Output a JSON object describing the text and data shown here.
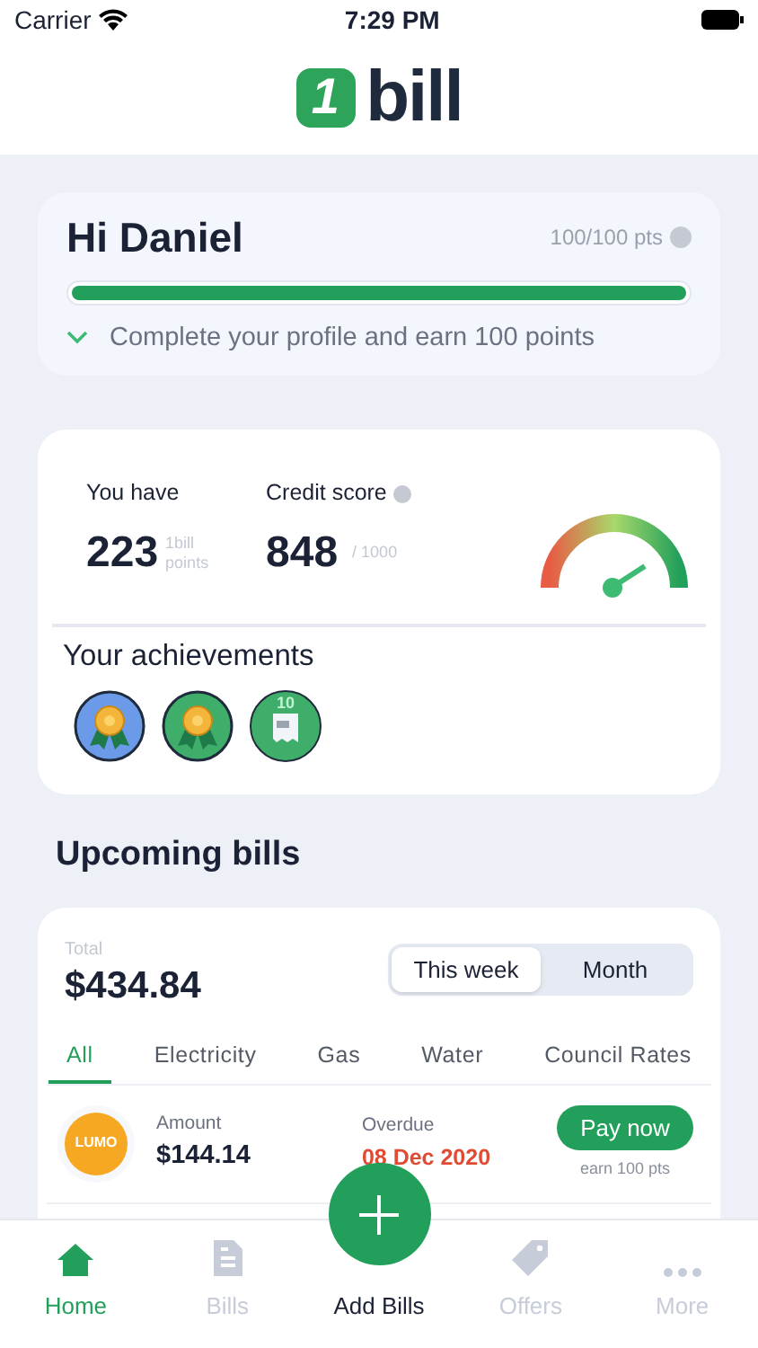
{
  "status_bar": {
    "carrier": "Carrier",
    "time": "7:29 PM"
  },
  "logo": {
    "mark": "1",
    "text": "bill"
  },
  "profile_card": {
    "greeting": "Hi Daniel",
    "points": "100/100 pts",
    "level": 1.0,
    "prompt": "Complete your profile and earn 100 points"
  },
  "stats_card": {
    "points_label": "You have",
    "points_value": "223",
    "points_unit_1": "1bill",
    "points_unit_2": "points",
    "score_label": "Credit score",
    "score_value": "848",
    "score_max": "/ 1000",
    "achievements_title": "Your achievements",
    "achievements": [
      {
        "kind": "medal",
        "color": "#6b9be8"
      },
      {
        "kind": "medal",
        "color": "#3fae6a"
      },
      {
        "kind": "receipt",
        "color": "#3fae6a",
        "number": "10"
      }
    ]
  },
  "upcoming": {
    "title": "Upcoming bills",
    "total_label": "Total",
    "total": "$434.84",
    "periods": [
      {
        "label": "This week",
        "selected": true
      },
      {
        "label": "Month",
        "selected": false
      }
    ],
    "tabs": [
      {
        "label": "All",
        "selected": true
      },
      {
        "label": "Electricity",
        "selected": false
      },
      {
        "label": "Gas",
        "selected": false
      },
      {
        "label": "Water",
        "selected": false
      },
      {
        "label": "Council Rates",
        "selected": false
      }
    ],
    "bills": [
      {
        "provider": "LUMO",
        "amount_label": "Amount",
        "amount": "$144.14",
        "status_label": "Overdue",
        "date": "08 Dec 2020",
        "action": "Pay now",
        "reward": "earn 100 pts"
      }
    ]
  },
  "nav": [
    {
      "kind": "home",
      "label": "Home",
      "selected": true
    },
    {
      "kind": "bills",
      "label": "Bills",
      "selected": false
    },
    {
      "kind": "add",
      "label": "Add Bills",
      "selected": false
    },
    {
      "kind": "offers",
      "label": "Offers",
      "selected": false
    },
    {
      "kind": "more",
      "label": "More",
      "selected": false
    }
  ]
}
